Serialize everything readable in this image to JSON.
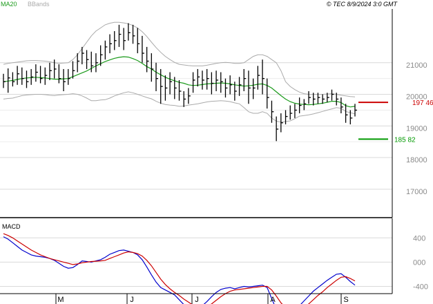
{
  "header": {
    "legend": [
      {
        "label": "MA20",
        "color": "#1a9a1a"
      },
      {
        "label": "BBands",
        "color": "#aaaaaa"
      }
    ],
    "copyright": "© TEC 8/9/2024 3:0 GMT"
  },
  "chart_data": [
    {
      "type": "ohlc",
      "title": "",
      "x_month_labels": [
        "M",
        "J",
        "J",
        "A",
        "S"
      ],
      "y_ticks": [
        17000,
        18000,
        19000,
        20000,
        21000
      ],
      "y_tick_labels": [
        "17000",
        "18000",
        "19000",
        "20000",
        "21000"
      ],
      "ylim": [
        16100,
        22700
      ],
      "grid": true,
      "legend_position": "top-left",
      "resistance": {
        "value": 19746,
        "label": "197 46",
        "color": "#cc0000"
      },
      "support": {
        "value": 18582,
        "label": "185 82",
        "color": "#009900"
      },
      "series": [
        {
          "name": "MA20",
          "color": "#1a9a1a",
          "y": [
            20400,
            20420,
            20440,
            20470,
            20500,
            20520,
            20530,
            20540,
            20530,
            20520,
            20500,
            20480,
            20480,
            20490,
            20500,
            20560,
            20620,
            20680,
            20740,
            20820,
            20900,
            20970,
            21040,
            21090,
            21140,
            21170,
            21190,
            21180,
            21130,
            21070,
            20980,
            20880,
            20800,
            20700,
            20620,
            20540,
            20480,
            20430,
            20380,
            20350,
            20300,
            20280,
            20290,
            20310,
            20330,
            20340,
            20350,
            20360,
            20350,
            20330,
            20300,
            20280,
            20260,
            20270,
            20290,
            20320,
            20330,
            20280,
            20200,
            20080,
            19960,
            19850,
            19770,
            19720,
            19690,
            19680,
            19670,
            19680,
            19700,
            19720,
            19750,
            19780,
            19780,
            19740,
            19640,
            19600,
            19620
          ]
        },
        {
          "name": "BBands",
          "color": "#aaaaaa",
          "upper": [
            20950,
            20980,
            21000,
            21020,
            21040,
            21060,
            21070,
            21070,
            21060,
            21050,
            21030,
            21000,
            20980,
            20990,
            21000,
            21100,
            21250,
            21450,
            21650,
            21850,
            22000,
            22100,
            22200,
            22250,
            22280,
            22280,
            22260,
            22230,
            22180,
            22100,
            21980,
            21830,
            21650,
            21480,
            21330,
            21200,
            21100,
            21010,
            20950,
            20930,
            20910,
            20900,
            20900,
            20900,
            20920,
            20950,
            20980,
            21000,
            21010,
            21000,
            20980,
            20980,
            21000,
            21100,
            21200,
            21250,
            21250,
            21200,
            21100,
            21000,
            20750,
            20400,
            20250,
            20150,
            20070,
            20020,
            20000,
            20000,
            20000,
            20000,
            20010,
            20020,
            20000,
            19970,
            19950,
            19930,
            19920
          ],
          "lower": [
            19850,
            19870,
            19880,
            19920,
            19960,
            19980,
            19990,
            20000,
            20000,
            19990,
            19970,
            19960,
            19980,
            19990,
            20000,
            20020,
            20000,
            19950,
            19880,
            19800,
            19800,
            19820,
            19830,
            19880,
            19950,
            20000,
            20050,
            20080,
            20050,
            20000,
            19950,
            19900,
            19860,
            19780,
            19720,
            19680,
            19660,
            19650,
            19620,
            19630,
            19660,
            19680,
            19700,
            19730,
            19760,
            19780,
            19790,
            19800,
            19790,
            19770,
            19730,
            19700,
            19580,
            19450,
            19400,
            19400,
            19450,
            19400,
            19250,
            19150,
            19120,
            19140,
            19160,
            19230,
            19310,
            19330,
            19350,
            19380,
            19420,
            19460,
            19500,
            19540,
            19580,
            19560,
            19460,
            19420,
            19380
          ]
        },
        {
          "name": "OHLC",
          "color": "#000000",
          "bars": [
            [
              20650,
              20200,
              20400
            ],
            [
              20820,
              20050,
              20520
            ],
            [
              20700,
              20250,
              20400
            ],
            [
              20900,
              20300,
              20650
            ],
            [
              20850,
              20300,
              20500
            ],
            [
              20750,
              20200,
              20400
            ],
            [
              20800,
              20300,
              20550
            ],
            [
              20950,
              20400,
              20700
            ],
            [
              20900,
              20350,
              20500
            ],
            [
              20850,
              20300,
              20600
            ],
            [
              21000,
              20450,
              20750
            ],
            [
              21100,
              20500,
              20800
            ],
            [
              20950,
              20350,
              20500
            ],
            [
              20800,
              20100,
              20400
            ],
            [
              20800,
              20300,
              20500
            ],
            [
              21050,
              20500,
              20750
            ],
            [
              21300,
              20700,
              21050
            ],
            [
              21500,
              20950,
              21300
            ],
            [
              21400,
              20800,
              21100
            ],
            [
              21350,
              20700,
              20900
            ],
            [
              21300,
              20700,
              21000
            ],
            [
              21550,
              20900,
              21250
            ],
            [
              21700,
              21100,
              21500
            ],
            [
              21900,
              21300,
              21600
            ],
            [
              22000,
              21400,
              21700
            ],
            [
              22200,
              21500,
              21900
            ],
            [
              22100,
              21400,
              21700
            ],
            [
              22250,
              21700,
              21950
            ],
            [
              22200,
              21600,
              21850
            ],
            [
              22100,
              21300,
              21600
            ],
            [
              21850,
              21000,
              21300
            ],
            [
              21500,
              20700,
              21050
            ],
            [
              21300,
              20400,
              20800
            ],
            [
              21000,
              20100,
              20500
            ],
            [
              20800,
              19700,
              20250
            ],
            [
              20600,
              19800,
              20200
            ],
            [
              20700,
              20000,
              20400
            ],
            [
              20550,
              19850,
              20200
            ],
            [
              20450,
              19800,
              20100
            ],
            [
              20100,
              19600,
              19850
            ],
            [
              20200,
              19700,
              19950
            ],
            [
              20700,
              20050,
              20450
            ],
            [
              20800,
              20250,
              20550
            ],
            [
              20750,
              20150,
              20450
            ],
            [
              20800,
              20150,
              20500
            ],
            [
              20700,
              20000,
              20350
            ],
            [
              20750,
              20100,
              20450
            ],
            [
              20700,
              20050,
              20400
            ],
            [
              20500,
              19900,
              20200
            ],
            [
              20600,
              20000,
              20300
            ],
            [
              20400,
              19800,
              20100
            ],
            [
              20550,
              19950,
              20300
            ],
            [
              20800,
              20100,
              20500
            ],
            [
              20750,
              19700,
              20200
            ],
            [
              20500,
              19850,
              20200
            ],
            [
              20900,
              20150,
              20600
            ],
            [
              21100,
              20000,
              20500
            ],
            [
              20500,
              19550,
              19900
            ],
            [
              19800,
              19100,
              19450
            ],
            [
              19300,
              18520,
              18900
            ],
            [
              19400,
              18800,
              19100
            ],
            [
              19500,
              19050,
              19300
            ],
            [
              19650,
              19200,
              19400
            ],
            [
              19700,
              19250,
              19500
            ],
            [
              19900,
              19400,
              19650
            ],
            [
              19850,
              19500,
              19700
            ],
            [
              20100,
              19700,
              19900
            ],
            [
              20050,
              19650,
              19850
            ],
            [
              20050,
              19700,
              19900
            ],
            [
              20000,
              19700,
              19850
            ],
            [
              20050,
              19750,
              19900
            ],
            [
              20150,
              19800,
              20000
            ],
            [
              20050,
              19650,
              19850
            ],
            [
              19900,
              19400,
              19600
            ],
            [
              19700,
              19100,
              19350
            ],
            [
              19500,
              19050,
              19250
            ],
            [
              19700,
              19300,
              19500
            ]
          ]
        }
      ]
    },
    {
      "type": "line",
      "title": "MACD",
      "y_ticks": [
        -400,
        0,
        400
      ],
      "y_tick_labels": [
        "-400",
        "000",
        "400"
      ],
      "ylim": [
        -520,
        700
      ],
      "series": [
        {
          "name": "MACD",
          "color": "#0000cc",
          "y": [
            420,
            380,
            320,
            260,
            200,
            160,
            120,
            100,
            90,
            80,
            60,
            30,
            -20,
            -70,
            -100,
            -90,
            -40,
            20,
            10,
            0,
            20,
            40,
            80,
            130,
            160,
            190,
            200,
            180,
            160,
            120,
            40,
            -80,
            -210,
            -330,
            -420,
            -460,
            -500,
            -540,
            -620,
            -700,
            -760,
            -800,
            -790,
            -720,
            -650,
            -570,
            -500,
            -450,
            -430,
            -420,
            -440,
            -420,
            -400,
            -410,
            -400,
            -390,
            -380,
            -420,
            -600,
            -780,
            -860,
            -880,
            -860,
            -800,
            -720,
            -640,
            -560,
            -480,
            -420,
            -360,
            -300,
            -250,
            -200,
            -190,
            -250,
            -320,
            -380
          ]
        },
        {
          "name": "Signal",
          "color": "#cc0000",
          "y": [
            470,
            440,
            400,
            350,
            300,
            250,
            200,
            160,
            120,
            90,
            60,
            40,
            20,
            0,
            -20,
            -40,
            -30,
            -10,
            0,
            10,
            15,
            20,
            30,
            60,
            90,
            120,
            150,
            170,
            160,
            140,
            100,
            30,
            -60,
            -170,
            -280,
            -370,
            -440,
            -500,
            -550,
            -610,
            -660,
            -710,
            -740,
            -750,
            -730,
            -690,
            -630,
            -570,
            -520,
            -480,
            -460,
            -450,
            -440,
            -430,
            -420,
            -410,
            -400,
            -400,
            -460,
            -560,
            -670,
            -750,
            -800,
            -810,
            -790,
            -750,
            -690,
            -620,
            -550,
            -490,
            -420,
            -360,
            -300,
            -250,
            -240,
            -270,
            -310
          ]
        }
      ]
    }
  ]
}
